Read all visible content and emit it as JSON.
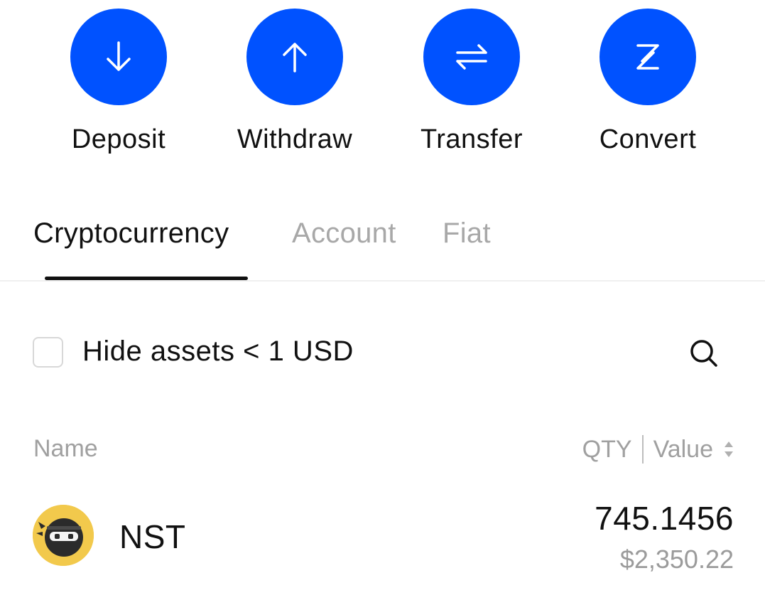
{
  "actions": [
    {
      "label": "Deposit",
      "icon": "arrow-down-icon"
    },
    {
      "label": "Withdraw",
      "icon": "arrow-up-icon"
    },
    {
      "label": "Transfer",
      "icon": "transfer-arrows-icon"
    },
    {
      "label": "Convert",
      "icon": "convert-icon"
    }
  ],
  "colors": {
    "accent": "#0052ff",
    "coin_bg": "#f2c94c"
  },
  "tabs": [
    {
      "label": "Cryptocurrency",
      "active": true
    },
    {
      "label": "Account",
      "active": false
    },
    {
      "label": "Fiat",
      "active": false
    }
  ],
  "filter": {
    "hide_small_label": "Hide assets < 1 USD",
    "checked": false
  },
  "columns": {
    "name": "Name",
    "qty": "QTY",
    "value": "Value"
  },
  "assets": [
    {
      "symbol": "NST",
      "qty": "745.1456",
      "value": "$2,350.22",
      "icon": "ninja-coin-icon"
    }
  ]
}
